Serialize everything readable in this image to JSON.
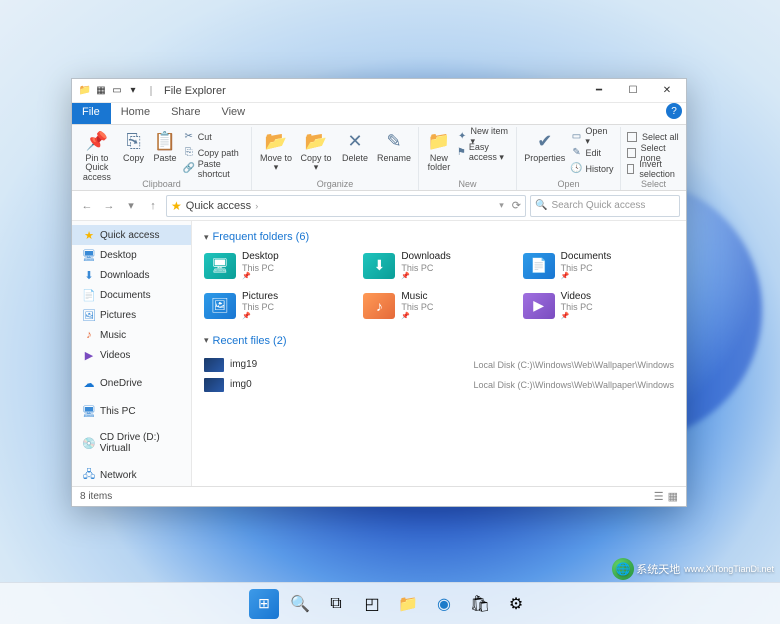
{
  "window": {
    "title": "File Explorer",
    "tabs": {
      "file": "File",
      "home": "Home",
      "share": "Share",
      "view": "View"
    }
  },
  "ribbon": {
    "clipboard": {
      "label": "Clipboard",
      "pin": "Pin to Quick access",
      "copy": "Copy",
      "paste": "Paste",
      "cut": "Cut",
      "copy_path": "Copy path",
      "paste_shortcut": "Paste shortcut"
    },
    "organize": {
      "label": "Organize",
      "move": "Move to ▾",
      "copy": "Copy to ▾",
      "delete": "Delete",
      "rename": "Rename"
    },
    "new": {
      "label": "New",
      "new_folder": "New folder",
      "new_item": "New item ▾",
      "easy_access": "Easy access ▾"
    },
    "open": {
      "label": "Open",
      "properties": "Properties",
      "open": "Open ▾",
      "edit": "Edit",
      "history": "History"
    },
    "select": {
      "label": "Select",
      "all": "Select all",
      "none": "Select none",
      "invert": "Invert selection"
    }
  },
  "nav": {
    "address_label": "Quick access",
    "search_placeholder": "Search Quick access"
  },
  "sidebar": {
    "items": [
      {
        "icon": "★",
        "name": "Quick access",
        "color": "#f7b500",
        "active": true,
        "key": "quick-access"
      },
      {
        "icon": "🖥",
        "name": "Desktop",
        "color": "#3a8ad6",
        "key": "desktop"
      },
      {
        "icon": "⬇",
        "name": "Downloads",
        "color": "#3a8ad6",
        "key": "downloads"
      },
      {
        "icon": "📄",
        "name": "Documents",
        "color": "#3a8ad6",
        "key": "documents"
      },
      {
        "icon": "🖼",
        "name": "Pictures",
        "color": "#3a8ad6",
        "key": "pictures"
      },
      {
        "icon": "♪",
        "name": "Music",
        "color": "#e56a3a",
        "key": "music"
      },
      {
        "icon": "▶",
        "name": "Videos",
        "color": "#7a4cc0",
        "key": "videos"
      },
      {
        "sep": true
      },
      {
        "icon": "☁",
        "name": "OneDrive",
        "color": "#1976d2",
        "key": "onedrive"
      },
      {
        "sep": true
      },
      {
        "icon": "🖥",
        "name": "This PC",
        "color": "#3a8ad6",
        "key": "this-pc"
      },
      {
        "sep": true
      },
      {
        "icon": "💿",
        "name": "CD Drive (D:) VirtualI",
        "color": "#888",
        "key": "cd-drive"
      },
      {
        "sep": true
      },
      {
        "icon": "🖧",
        "name": "Network",
        "color": "#3a8ad6",
        "key": "network"
      }
    ]
  },
  "content": {
    "frequent": {
      "header": "Frequent folders (6)",
      "items": [
        {
          "name": "Desktop",
          "sub": "This PC",
          "cls": "fi-teal",
          "icon": "🖥"
        },
        {
          "name": "Downloads",
          "sub": "This PC",
          "cls": "fi-teal",
          "icon": "⬇"
        },
        {
          "name": "Documents",
          "sub": "This PC",
          "cls": "fi-blue",
          "icon": "📄"
        },
        {
          "name": "Pictures",
          "sub": "This PC",
          "cls": "fi-blue",
          "icon": "🖼"
        },
        {
          "name": "Music",
          "sub": "This PC",
          "cls": "fi-orange",
          "icon": "♪"
        },
        {
          "name": "Videos",
          "sub": "This PC",
          "cls": "fi-purple",
          "icon": "▶"
        }
      ]
    },
    "recent": {
      "header": "Recent files (2)",
      "items": [
        {
          "name": "img19",
          "path": "Local Disk (C:)\\Windows\\Web\\Wallpaper\\Windows"
        },
        {
          "name": "img0",
          "path": "Local Disk (C:)\\Windows\\Web\\Wallpaper\\Windows"
        }
      ]
    }
  },
  "status": {
    "text": "8 items"
  },
  "watermark": {
    "text": "系统天地",
    "url": "www.XiTongTianDi.net"
  }
}
